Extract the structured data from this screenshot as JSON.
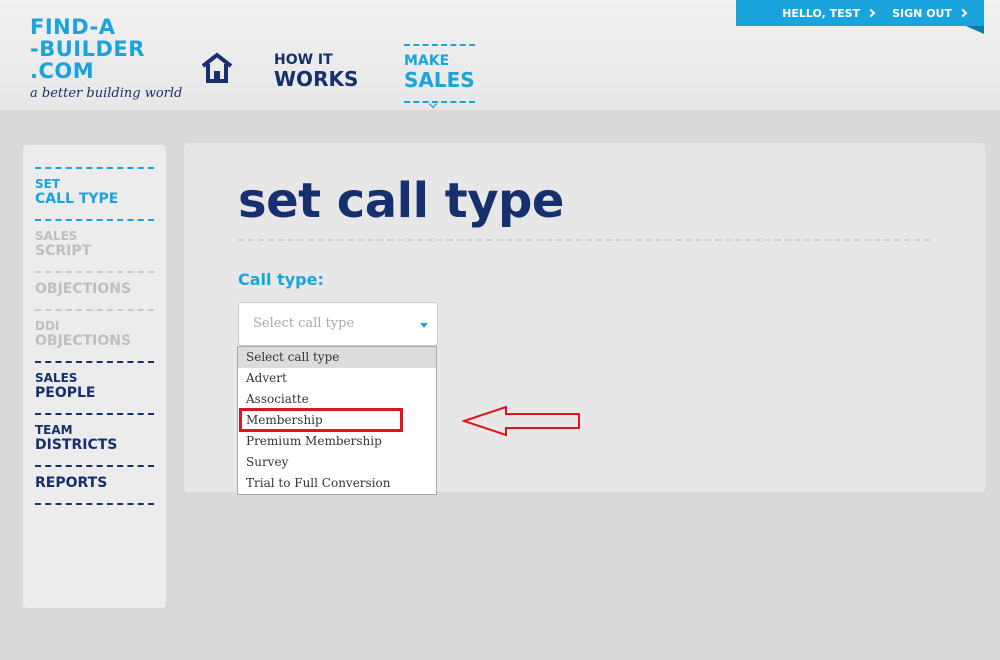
{
  "brand": {
    "logo_lines": [
      "FIND-A",
      "-BUILDER",
      ".COM"
    ],
    "tagline": "a better building world"
  },
  "nav": {
    "how": {
      "top": "HOW IT",
      "bottom": "WORKS"
    },
    "sales": {
      "top": "MAKE",
      "bottom": "SALES"
    }
  },
  "user": {
    "greeting": "HELLO, TEST",
    "sign_out": "SIGN OUT"
  },
  "sidebar": {
    "items": [
      {
        "l1": "SET",
        "l2": "CALL TYPE",
        "state": "active"
      },
      {
        "l1": "SALES",
        "l2": "SCRIPT",
        "state": "disabled"
      },
      {
        "l1": "",
        "l2": "OBJECTIONS",
        "state": "disabled"
      },
      {
        "l1": "DDI",
        "l2": "OBJECTIONS",
        "state": "disabled"
      },
      {
        "l1": "SALES",
        "l2": "PEOPLE",
        "state": "dark"
      },
      {
        "l1": "TEAM",
        "l2": "DISTRICTS",
        "state": "dark"
      },
      {
        "l1": "",
        "l2": "REPORTS",
        "state": "dark"
      }
    ]
  },
  "main": {
    "title": "set call type",
    "field_label": "Call type:",
    "select_placeholder": "Select call type",
    "options": [
      "Select call type",
      "Advert",
      "Associatte",
      "Membership",
      "Premium Membership",
      "Survey",
      "Trial to Full Conversion"
    ],
    "highlighted_option": "Membership"
  },
  "colors": {
    "accent": "#1aa3dc",
    "navy": "#16306e",
    "highlight": "#e0141e"
  }
}
